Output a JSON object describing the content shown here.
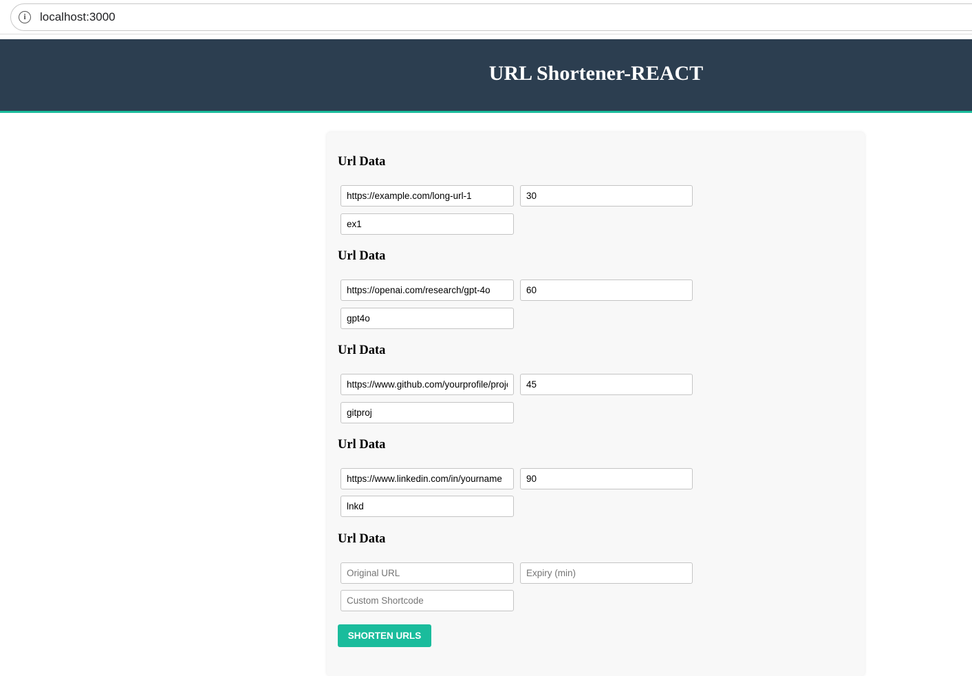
{
  "browser": {
    "address": "localhost:3000",
    "info_icon": "info-icon"
  },
  "header": {
    "title": "URL Shortener-REACT",
    "background": "#2c3e50",
    "accent": "#1abc9c"
  },
  "form": {
    "entries": [
      {
        "title": "Url Data",
        "url": "https://example.com/long-url-1",
        "expiry": "30",
        "shortcode": "ex1"
      },
      {
        "title": "Url Data",
        "url": "https://openai.com/research/gpt-4o",
        "expiry": "60",
        "shortcode": "gpt4o"
      },
      {
        "title": "Url Data",
        "url": "https://www.github.com/yourprofile/project",
        "expiry": "45",
        "shortcode": "gitproj"
      },
      {
        "title": "Url Data",
        "url": "https://www.linkedin.com/in/yourname",
        "expiry": "90",
        "shortcode": "lnkd"
      },
      {
        "title": "Url Data",
        "url": "",
        "expiry": "",
        "shortcode": ""
      }
    ],
    "placeholders": {
      "url": "Original URL",
      "expiry": "Expiry (min)",
      "shortcode": "Custom Shortcode"
    },
    "submit_label": "SHORTEN URLS"
  }
}
